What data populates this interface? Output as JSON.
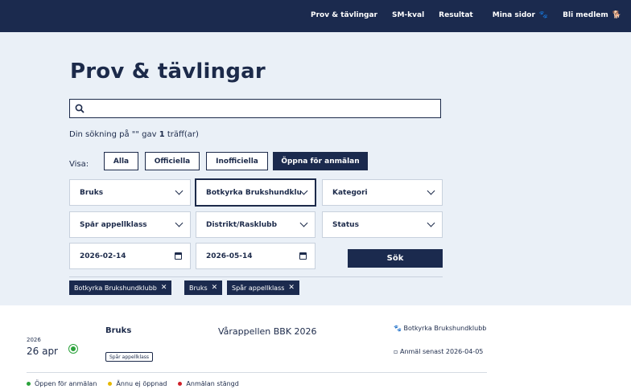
{
  "nav": {
    "prov": "Prov & tävlingar",
    "smkval": "SM-kval",
    "resultat": "Resultat",
    "mina_sidor": "Mina sidor",
    "bli_medlem": "Bli medlem"
  },
  "page": {
    "title": "Prov & tävlingar"
  },
  "search": {
    "value": "",
    "placeholder": ""
  },
  "result": {
    "prefix": "Din sökning på \"\" gav ",
    "count": "1",
    "suffix": " träff(ar)"
  },
  "visa": {
    "label": "Visa:",
    "options": [
      "Alla",
      "Officiella",
      "Inofficiella",
      "Öppna för anmälan"
    ],
    "active": "Öppna för anmälan"
  },
  "filters": {
    "gren": "Bruks",
    "klubb": "Botkyrka Brukshundklubb",
    "kategori": "Kategori",
    "klass": "Spår appellklass",
    "distrikt": "Distrikt/Rasklubb",
    "status": "Status",
    "date_from": "2026-02-14",
    "date_to": "2026-05-14",
    "search_button": "Sök"
  },
  "active_tags": [
    "Botkyrka Brukshundklubb",
    "Bruks",
    "Spår appellklass"
  ],
  "events": [
    {
      "year": "2026",
      "date": "26 apr",
      "status": "open",
      "type": "Bruks",
      "class_badge": "Spår appellklass",
      "name": "Vårappellen BBK 2026",
      "club": "Botkyrka Brukshundklubb",
      "deadline": "Anmäl senast 2026-04-05"
    }
  ],
  "legend": {
    "open": "Öppen för anmälan",
    "not_open": "Ännu ej öppnad",
    "closed": "Anmälan stängd"
  },
  "colors": {
    "navy": "#1b2a4e",
    "hero_bg": "#eaf0f7",
    "open": "#2ba23b",
    "not_open": "#e6b800",
    "closed": "#d0202a"
  }
}
